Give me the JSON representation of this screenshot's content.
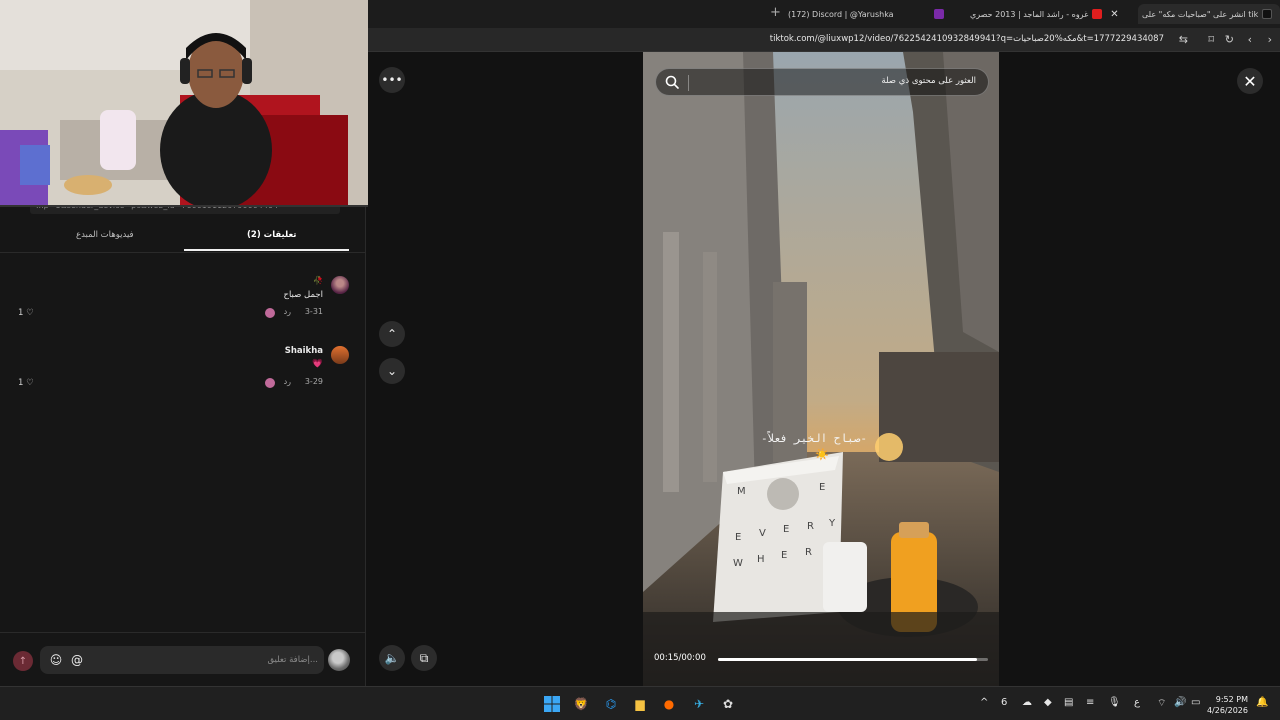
{
  "browser": {
    "tabs": [
      {
        "label": "انشر على \"صباحيات مكه\" على tik",
        "active": true
      },
      {
        "label": "غروه - راشد الماجد | 2013 حصري",
        "active": false
      },
      {
        "label": "(172) Discord | @Yarushka",
        "active": false
      }
    ],
    "url": "tiktok.com/@liuxwp12/video/7622542410932849941?q=مكه%20صباحيات&t=1777229434087"
  },
  "left_panel": {
    "url_fragment": "...p=1&sender_device=pc&web_id=7600191120790004404",
    "tabs": [
      {
        "label": "تعليقات (2)",
        "active": true
      },
      {
        "label": "فيديوهات المبدع",
        "active": false
      }
    ],
    "comments": [
      {
        "emoji": "🥀",
        "text": "اجمل صباح",
        "date": "3-31",
        "reply": "رد",
        "likes": "1"
      },
      {
        "author": "Shaikha",
        "emoji": "💗",
        "date": "3-29",
        "reply": "رد",
        "likes": "1"
      }
    ],
    "comment_input": {
      "placeholder": "إضافة تعليق..."
    }
  },
  "video": {
    "search_placeholder": "العثور على محتوى ذي صلة",
    "overlay_text": "-صباح الخير فعلاً-",
    "overlay_emoji": "☀️",
    "bag_letters": [
      "M",
      "E",
      "E",
      "V",
      "E",
      "R",
      "Y",
      "W",
      "H",
      "E",
      "R"
    ],
    "time": "00:15/00:00",
    "progress_percent": 96
  },
  "taskbar": {
    "time": "9:52 PM",
    "date": "4/26/2026",
    "lang": "ع",
    "num": "6"
  }
}
